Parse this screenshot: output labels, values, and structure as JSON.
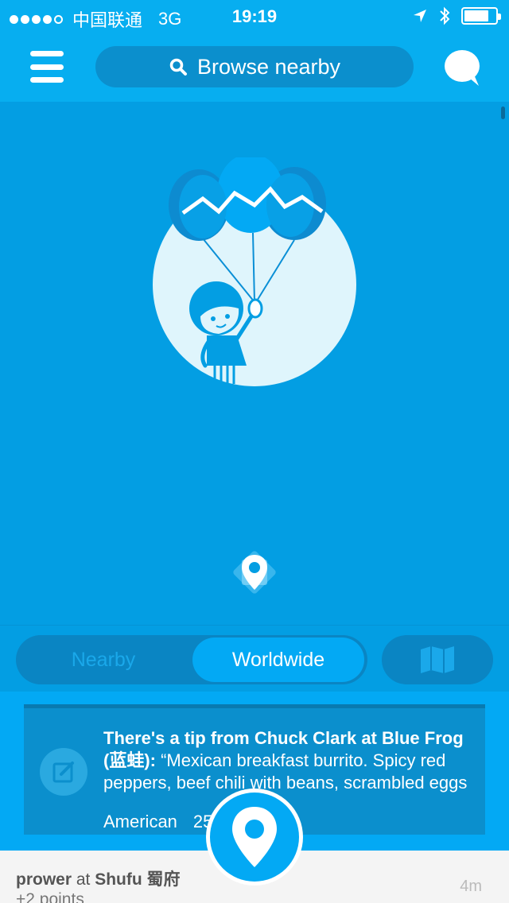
{
  "status_bar": {
    "signal_dots": [
      true,
      true,
      true,
      true,
      false
    ],
    "carrier": "中国联通",
    "network": "3G",
    "time": "19:19",
    "icons": [
      "location-arrow-icon",
      "bluetooth-icon",
      "battery-icon"
    ],
    "battery_level": 0.8
  },
  "nav": {
    "menu_icon": "hamburger-menu-icon",
    "search_icon": "search-icon",
    "search_label": "Browse nearby",
    "chat_icon": "speech-bubble-icon"
  },
  "hero": {
    "illustration": "girl-with-balloons",
    "locate_icon": "location-pin-icon"
  },
  "toggle": {
    "options": [
      "Nearby",
      "Worldwide"
    ],
    "selected": "Worldwide",
    "map_icon": "map-icon"
  },
  "tip_card": {
    "icon": "edit-note-icon",
    "heading": "There's a tip from Chuck Clark at Blue Frog (蓝蛙):",
    "quote": "“Mexican breakfast burrito. Spicy red peppers, beef chili with beans, scrambled eggs",
    "category": "American",
    "distance": "25"
  },
  "checkin": {
    "user": "prower",
    "connector": "at",
    "venue": "Shufu 蜀府",
    "points": "+2 points",
    "time_ago": "4m"
  },
  "fab": {
    "icon": "check-in-pin-icon"
  },
  "colors": {
    "primary": "#03a9f4",
    "dark": "#0b8fcd",
    "darker": "#0a85c3"
  }
}
